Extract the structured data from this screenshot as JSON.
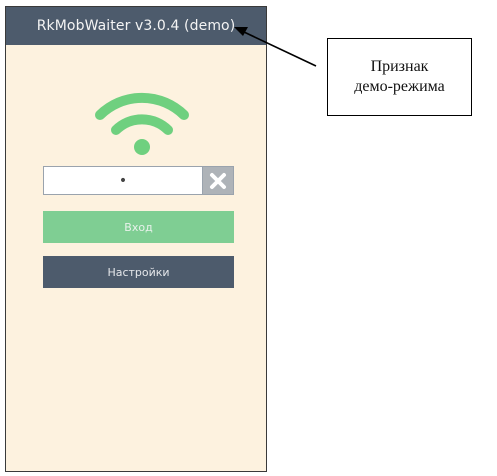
{
  "app": {
    "title": "RkMobWaiter v3.0.4 (demo)"
  },
  "status": {
    "icon": "wifi-icon",
    "color": "#6fd07f"
  },
  "login": {
    "pin_value": "•",
    "clear_icon": "close-icon",
    "login_label": "Вход",
    "settings_label": "Настройки"
  },
  "annotation": {
    "line1": "Признак",
    "line2": "демо-режима"
  },
  "colors": {
    "header": "#4d5b6c",
    "background": "#fdf2df",
    "login_button": "#7fce93",
    "settings_button": "#4d5b6c"
  }
}
